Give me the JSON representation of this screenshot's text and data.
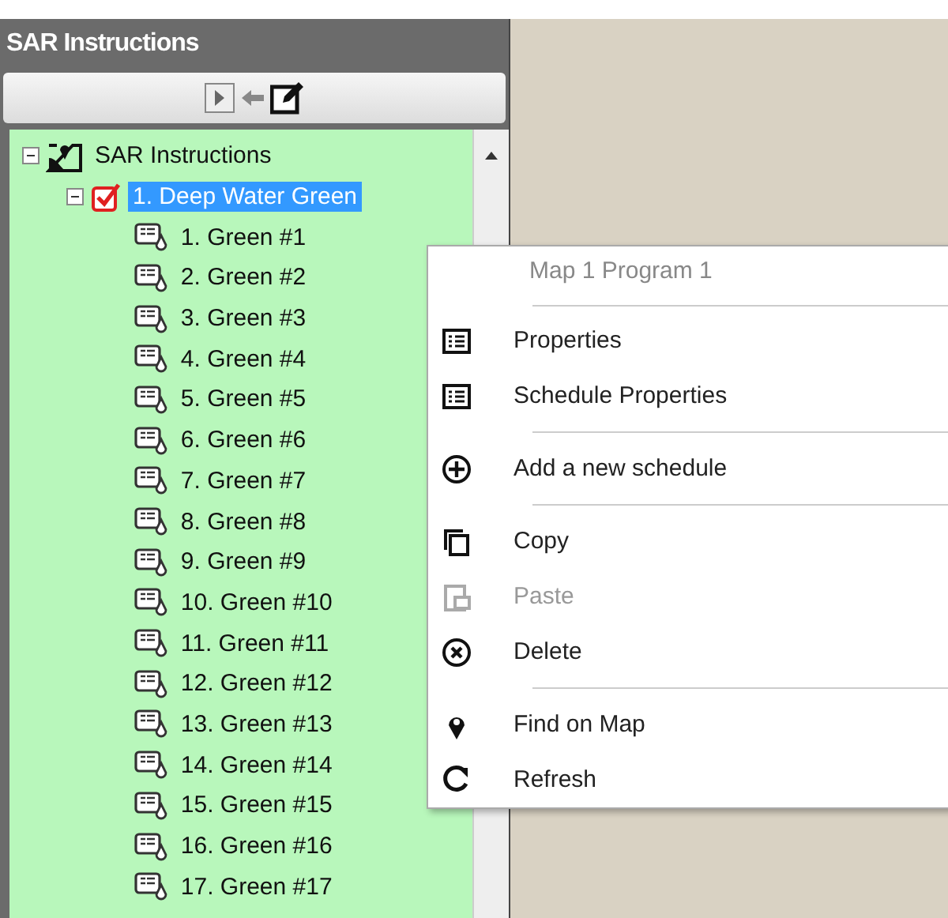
{
  "panel": {
    "title": "SAR Instructions"
  },
  "tree": [
    {
      "label": "SAR Instructions",
      "expanded": true,
      "children": [
        {
          "label": "1. Deep Water Green",
          "expanded": true,
          "checked": true,
          "selected": true,
          "children": [
            {
              "label": "1. Green #1",
              "selected": false
            },
            {
              "label": "2. Green #2",
              "selected": false
            },
            {
              "label": "3. Green #3",
              "selected": false
            },
            {
              "label": "4. Green #4",
              "selected": false
            },
            {
              "label": "5. Green #5",
              "selected": false
            },
            {
              "label": "6. Green #6",
              "selected": false
            },
            {
              "label": "7. Green #7",
              "selected": false
            },
            {
              "label": "8. Green #8",
              "selected": false
            },
            {
              "label": "9. Green #9",
              "selected": false
            },
            {
              "label": "10. Green #10",
              "selected": false
            },
            {
              "label": "11. Green #11",
              "selected": false
            },
            {
              "label": "12. Green #12",
              "selected": false
            },
            {
              "label": "13. Green #13",
              "selected": false
            },
            {
              "label": "14. Green #14",
              "selected": false
            },
            {
              "label": "15. Green #15",
              "selected": false
            },
            {
              "label": "16. Green #16",
              "selected": false
            },
            {
              "label": "17. Green #17",
              "selected": false
            }
          ]
        }
      ]
    }
  ],
  "context_menu": {
    "header": "Map 1 Program 1",
    "items": [
      {
        "kind": "separator"
      },
      {
        "kind": "item",
        "label": "Properties",
        "disabled": false
      },
      {
        "kind": "item",
        "label": "Schedule Properties",
        "disabled": false
      },
      {
        "kind": "separator"
      },
      {
        "kind": "item",
        "label": "Add a new schedule",
        "disabled": false
      },
      {
        "kind": "separator"
      },
      {
        "kind": "item",
        "label": "Copy",
        "disabled": false
      },
      {
        "kind": "item",
        "label": "Paste",
        "disabled": true
      },
      {
        "kind": "item",
        "label": "Delete",
        "disabled": false
      },
      {
        "kind": "separator"
      },
      {
        "kind": "item",
        "label": "Find on Map",
        "disabled": false
      },
      {
        "kind": "item",
        "label": "Refresh",
        "disabled": false
      }
    ]
  }
}
